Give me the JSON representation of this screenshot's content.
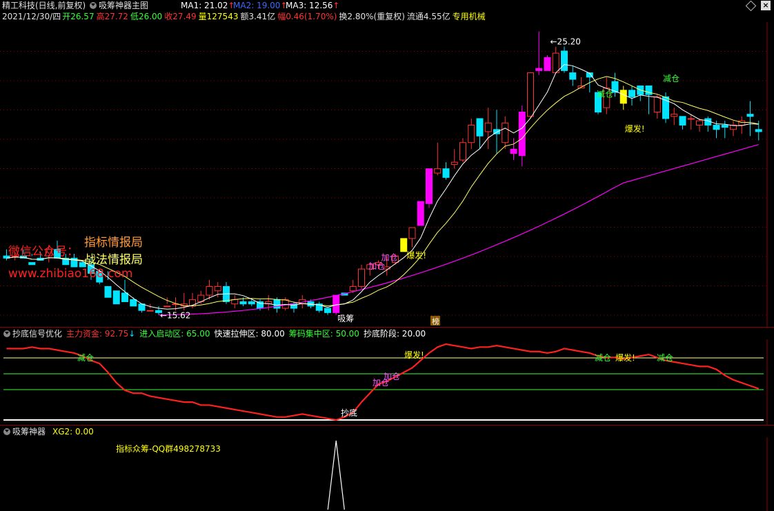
{
  "window": {
    "stock": "精工科技(日线,前复权)",
    "indicator_name": "吸筹神器主图",
    "ma1_label": "MA1: 21.02",
    "ma2_label": "MA2: 19.00",
    "ma3_label": "MA3: 12.56",
    "close_icon": "close-icon",
    "diamond_icon": "diamond-icon"
  },
  "quote": {
    "date": "2021/12/30/四",
    "open": "开26.57",
    "high": "高27.72",
    "low": "低26.00",
    "close": "收27.49",
    "volume": "量127543",
    "amount": "额3.41亿",
    "change": "幅0.46(1.70%)",
    "turnover": "换2.80%(重复权)",
    "float": "流通4.55亿",
    "special": "专用机械"
  },
  "watermark": {
    "line1": "指标情报局",
    "line2": "微信公众号：",
    "line3": "战法情报局",
    "line4": "www.zhibiao168.com"
  },
  "panel2": {
    "name": "抄底信号优化",
    "main_fund": "主力资金: 92.75",
    "enter_zone": "进入启动区: 65.00",
    "fast_zone": "快速拉伸区: 80.00",
    "chip_zone": "筹码集中区: 50.00",
    "bottom_stage": "抄底阶段: 20.00"
  },
  "panel3": {
    "name": "吸筹神器",
    "xg2": "XG2: 0.00",
    "note": "指标众筹-QQ群498278733"
  },
  "colors": {
    "up": "#ff3232",
    "down": "#00e4ff",
    "yellow_candle": "#ffff00",
    "magenta_candle": "#ff00ff",
    "ma1": "#ffffff",
    "ma2": "#ffff66",
    "ma3": "#ff00ff",
    "grid": "#8c0000"
  },
  "chart_data": [
    {
      "type": "candlestick",
      "title": "吸筹神器主图",
      "ohlc": [
        [
          15.6,
          15.9,
          15.5,
          15.4
        ],
        [
          15.6,
          15.8,
          15.6,
          15.4
        ],
        [
          15.6,
          15.9,
          15.5,
          15.7
        ],
        [
          15.3,
          15.7,
          15.2,
          15.6
        ],
        [
          15.5,
          15.8,
          15.4,
          15.4
        ],
        [
          15.6,
          16.1,
          15.9,
          15.3
        ],
        [
          15.9,
          16.3,
          15.5,
          15.8
        ],
        [
          15.5,
          15.7,
          15.2,
          15.4
        ],
        [
          15.5,
          15.7,
          15.1,
          15.4
        ],
        [
          15.3,
          15.4,
          15.1,
          15.1
        ],
        [
          15.2,
          15.5,
          14.8,
          14.5
        ],
        [
          14.9,
          15.0,
          14.4,
          14.3
        ],
        [
          14.2,
          14.9,
          13.7,
          14.5
        ],
        [
          14.0,
          14.0,
          13.4,
          13.6
        ],
        [
          13.9,
          14.5,
          13.5,
          13.5
        ],
        [
          13.6,
          13.7,
          13.3,
          13.4
        ],
        [
          13.4,
          13.4,
          13.1,
          13.0
        ],
        [
          13.1,
          13.4,
          13.1,
          13.2
        ],
        [
          13.1,
          13.3,
          13.0,
          12.9
        ],
        [
          13.3,
          13.7,
          13.3,
          13.4
        ],
        [
          13.4,
          13.7,
          13.4,
          13.1
        ],
        [
          13.3,
          13.9,
          13.4,
          13.1
        ],
        [
          13.3,
          13.9,
          13.6,
          13.2
        ],
        [
          13.5,
          14.0,
          13.8,
          13.4
        ],
        [
          13.8,
          14.5,
          14.2,
          13.6
        ],
        [
          14.0,
          14.4,
          14.2,
          13.7
        ],
        [
          14.2,
          14.4,
          13.5,
          13.4
        ],
        [
          13.4,
          13.8,
          13.6,
          13.2
        ],
        [
          13.5,
          13.7,
          13.4,
          13.3
        ],
        [
          13.5,
          13.6,
          13.4,
          13.3
        ],
        [
          13.5,
          13.6,
          13.2,
          13.1
        ],
        [
          13.4,
          13.8,
          13.5,
          13.1
        ],
        [
          13.6,
          13.7,
          13.2,
          13.0
        ],
        [
          13.2,
          13.7,
          13.6,
          13.1
        ],
        [
          13.4,
          13.5,
          13.2,
          13.0
        ],
        [
          13.4,
          13.8,
          13.6,
          13.2
        ],
        [
          13.5,
          13.6,
          13.3,
          13.2
        ],
        [
          13.4,
          13.5,
          13.1,
          13.0
        ],
        [
          13.2,
          13.2,
          13.0,
          12.9
        ],
        [
          13.0,
          13.8,
          13.8,
          12.9
        ],
        [
          13.9,
          13.9,
          13.8,
          13.8
        ],
        [
          14.0,
          14.5,
          14.2,
          13.9
        ],
        [
          14.2,
          15.2,
          15.0,
          14.1
        ],
        [
          15.0,
          15.3,
          15.2,
          14.7
        ],
        [
          15.2,
          15.4,
          15.3,
          15.0
        ],
        [
          15.0,
          15.6,
          15.1,
          14.7
        ],
        [
          15.3,
          15.7,
          15.6,
          15.2
        ],
        [
          15.8,
          16.3,
          16.4,
          15.8
        ],
        [
          16.4,
          16.9,
          16.9,
          16.0
        ],
        [
          17.0,
          18.0,
          18.1,
          17.0
        ],
        [
          18.0,
          19.5,
          19.6,
          17.8
        ],
        [
          19.4,
          20.8,
          19.6,
          19.3
        ],
        [
          19.6,
          19.9,
          19.2,
          19.1
        ],
        [
          19.8,
          20.5,
          19.9,
          19.6
        ],
        [
          20.0,
          21.0,
          20.8,
          19.9
        ],
        [
          20.8,
          21.9,
          21.6,
          20.5
        ],
        [
          21.9,
          21.9,
          21.1,
          20.5
        ],
        [
          21.3,
          22.4,
          21.7,
          20.5
        ],
        [
          21.4,
          22.3,
          21.2,
          20.3
        ],
        [
          20.8,
          22.0,
          21.7,
          20.5
        ],
        [
          20.3,
          21.0,
          20.5,
          20.0
        ],
        [
          20.2,
          22.5,
          22.2,
          19.7
        ],
        [
          22.0,
          24.0,
          24.0,
          21.9
        ],
        [
          24.1,
          25.9,
          24.2,
          23.9
        ],
        [
          24.1,
          24.8,
          24.7,
          24.4
        ],
        [
          24.0,
          25.2,
          24.9,
          24.3
        ],
        [
          25.0,
          25.2,
          24.1,
          24.0
        ],
        [
          24.0,
          24.3,
          23.7,
          23.4
        ],
        [
          23.3,
          23.8,
          23.4,
          23.3
        ],
        [
          24.0,
          24.0,
          23.8,
          23.1
        ],
        [
          23.1,
          23.1,
          22.2,
          22.1
        ],
        [
          22.4,
          23.8,
          23.3,
          22.1
        ],
        [
          23.6,
          24.0,
          23.1,
          22.9
        ],
        [
          23.2,
          23.4,
          22.6,
          22.3
        ],
        [
          23.2,
          23.4,
          22.9,
          22.5
        ],
        [
          23.4,
          23.4,
          23.0,
          22.7
        ],
        [
          23.4,
          23.2,
          23.0,
          22.1
        ],
        [
          22.2,
          23.0,
          22.9,
          21.9
        ],
        [
          22.9,
          23.1,
          21.9,
          21.7
        ],
        [
          22.0,
          22.4,
          22.1,
          21.6
        ],
        [
          22.0,
          22.0,
          21.6,
          21.4
        ],
        [
          21.9,
          22.1,
          21.9,
          21.4
        ],
        [
          21.6,
          21.9,
          21.8,
          21.3
        ],
        [
          21.9,
          22.0,
          21.6,
          21.3
        ],
        [
          21.6,
          21.8,
          21.4,
          21.0
        ],
        [
          21.6,
          21.8,
          21.5,
          21.0
        ],
        [
          21.4,
          21.8,
          21.6,
          21.1
        ],
        [
          21.6,
          22.0,
          21.8,
          21.2
        ],
        [
          22.1,
          22.7,
          22.0,
          21.1
        ],
        [
          21.4,
          21.8,
          21.3,
          20.9
        ]
      ],
      "annotations": {
        "high_label": "25.20",
        "low_label": "15.62",
        "xichou": "吸筹",
        "jiacang": "加仓",
        "baofa": "爆发!",
        "jiancang": "减仓",
        "bang": "榜"
      }
    },
    {
      "type": "line",
      "title": "抄底信号优化",
      "series": [
        {
          "name": "主力资金",
          "values": [
            88,
            88,
            88,
            89,
            88,
            88,
            87,
            86,
            85,
            83,
            80,
            78,
            72,
            65,
            60,
            58,
            58,
            56,
            55,
            54,
            53,
            52,
            52,
            50,
            50,
            49,
            48,
            47,
            46,
            45,
            44,
            43,
            42,
            42,
            43,
            44,
            43,
            42,
            41,
            40,
            42,
            45,
            52,
            58,
            64,
            66,
            69,
            72,
            75,
            80,
            85,
            89,
            91,
            90,
            89,
            88,
            89,
            89,
            90,
            89,
            88,
            87,
            86,
            86,
            85,
            86,
            88,
            87,
            86,
            85,
            83,
            82,
            82,
            81,
            82,
            83,
            84,
            82,
            80,
            79,
            78,
            77,
            76,
            76,
            74,
            70,
            67,
            65,
            63,
            61
          ]
        }
      ],
      "levels": {
        "fast": 80,
        "enter": 65,
        "chip": 50,
        "bottom": 20
      },
      "annotations": {
        "jiancang": "减仓",
        "baofa": "爆发!",
        "jiacang": "加仓",
        "chaodi": "抄底"
      }
    },
    {
      "type": "line",
      "title": "吸筹神器",
      "series": [
        {
          "name": "XG2",
          "values": [
            0,
            0,
            0,
            0,
            0,
            0,
            0,
            0,
            0,
            0,
            0,
            0,
            0,
            0,
            0,
            0,
            0,
            0,
            0,
            0,
            0,
            0,
            0,
            0,
            0,
            0,
            0,
            0,
            0,
            0,
            0,
            0,
            0,
            0,
            0,
            0,
            0,
            0,
            0,
            1,
            0,
            0,
            0,
            0,
            0,
            0,
            0,
            0,
            0,
            0,
            0,
            0,
            0,
            0,
            0,
            0,
            0,
            0,
            0,
            0,
            0,
            0,
            0,
            0,
            0,
            0,
            0,
            0,
            0,
            0,
            0,
            0,
            0,
            0,
            0,
            0,
            0,
            0,
            0,
            0,
            0,
            0,
            0,
            0,
            0,
            0,
            0,
            0,
            0,
            0
          ]
        }
      ]
    }
  ]
}
